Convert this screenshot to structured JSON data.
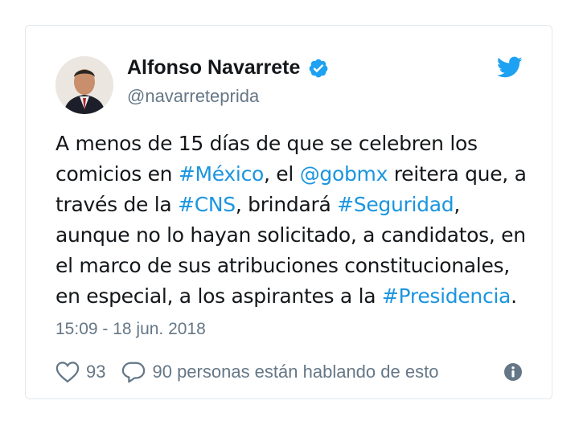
{
  "tweet": {
    "author_name": "Alfonso Navarrete",
    "author_handle": "@navarreteprida",
    "text_lines": [
      [
        {
          "t": "A menos de 15 días de que se celebren los",
          "link": false
        }
      ],
      [
        {
          "t": "comicios en ",
          "link": false
        },
        {
          "t": "#México",
          "link": true
        },
        {
          "t": ", el ",
          "link": false
        },
        {
          "t": "@gobmx",
          "link": true
        },
        {
          "t": " reitera que, a",
          "link": false
        }
      ],
      [
        {
          "t": "través de la ",
          "link": false
        },
        {
          "t": "#CNS",
          "link": true
        },
        {
          "t": ", brindará ",
          "link": false
        },
        {
          "t": "#Seguridad",
          "link": true
        },
        {
          "t": ",",
          "link": false
        }
      ],
      [
        {
          "t": "aunque no lo hayan solicitado, a candidatos, en",
          "link": false
        }
      ],
      [
        {
          "t": "el marco de sus atribuciones constitucionales,",
          "link": false
        }
      ],
      [
        {
          "t": "en especial, a los aspirantes a la ",
          "link": false
        },
        {
          "t": "#Presidencia",
          "link": true
        },
        {
          "t": ".",
          "link": false
        }
      ]
    ],
    "timestamp": "15:09 - 18 jun. 2018",
    "likes_count": "93",
    "conversation_text": "90 personas están hablando de esto"
  },
  "icons": {
    "verified": "verified-badge-icon",
    "logo": "twitter-bird-icon",
    "like": "heart-icon",
    "reply": "speech-bubble-icon",
    "info": "info-icon"
  },
  "colors": {
    "link": "#1b95e0",
    "text": "#14171a",
    "secondary": "#657786",
    "twitter_blue": "#1da1f2",
    "border": "#e1e8ed"
  }
}
